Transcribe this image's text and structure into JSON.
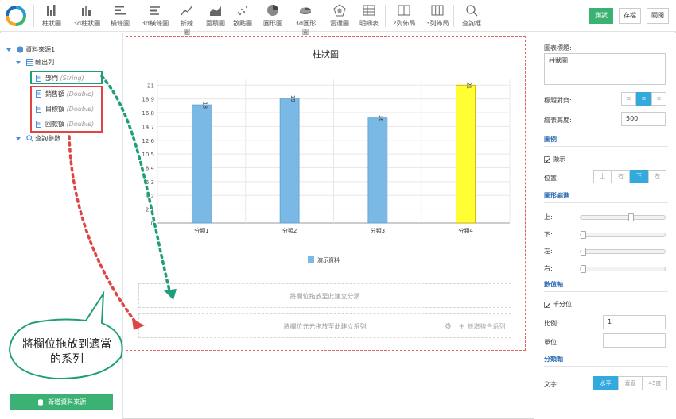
{
  "toolbar": {
    "items": [
      {
        "label": "柱狀圖",
        "icon": "bar-chart-icon"
      },
      {
        "label": "3d柱狀圖",
        "icon": "bar-3d-chart-icon"
      },
      {
        "label": "橫條圖",
        "icon": "horizontal-bar-icon"
      },
      {
        "label": "3d橫條圖",
        "icon": "horizontal-bar-3d-icon"
      },
      {
        "label": "折線圖",
        "icon": "line-chart-icon"
      },
      {
        "label": "面積圖",
        "icon": "area-chart-icon"
      },
      {
        "label": "散點圖",
        "icon": "scatter-chart-icon"
      },
      {
        "label": "圓形圖",
        "icon": "pie-chart-icon"
      },
      {
        "label": "3d圓形圖",
        "icon": "pie-3d-chart-icon"
      },
      {
        "label": "雷達圖",
        "icon": "radar-chart-icon"
      },
      {
        "label": "明細表",
        "icon": "table-icon"
      },
      {
        "label": "2列佈局",
        "icon": "two-column-layout-icon"
      },
      {
        "label": "3列佈局",
        "icon": "three-column-layout-icon"
      },
      {
        "label": "查詢框",
        "icon": "search-icon"
      }
    ],
    "test_label": "測試",
    "save_label": "存檔",
    "close_label": "關閉",
    "accent": "#3bb273"
  },
  "left": {
    "datasource": "資料來源1",
    "output": "輸出列",
    "fields": [
      {
        "name": "部門",
        "type": "(String)"
      },
      {
        "name": "銷售額",
        "type": "(Double)"
      },
      {
        "name": "目標額",
        "type": "(Double)"
      },
      {
        "name": "回款額",
        "type": "(Double)"
      }
    ],
    "query_params": "查詢參數",
    "add_source": "新增資料來源"
  },
  "center": {
    "dropzone_category": "將欄位拖放至此建立分類",
    "dropzone_series": "將欄位元元拖放至此建立系列",
    "add_combo": "新增複合系列",
    "callout": "將欄位拖放到適當的系列"
  },
  "chart_data": {
    "type": "bar",
    "title": "柱狀圖",
    "categories": [
      "分類1",
      "分類2",
      "分類3",
      "分類4"
    ],
    "series": [
      {
        "name": "演示資料",
        "values": [
          18,
          19,
          16,
          21
        ]
      }
    ],
    "bar_labels": [
      "18",
      "19",
      "16",
      "21"
    ],
    "ylim": [
      0,
      22
    ],
    "yticks": [
      "0",
      "2.1",
      "4.2",
      "6.3",
      "8.4",
      "10.5",
      "12.6",
      "14.7",
      "16.8",
      "18.9",
      "21"
    ],
    "bar_color": "#7ab8e6",
    "highlight_color": "#ffff33",
    "highlight_index": 3,
    "legend": "bottom",
    "grid": true
  },
  "right": {
    "chart_title_label": "圖表標題:",
    "chart_title_value": "柱狀圖",
    "title_align_label": "標題對齊:",
    "align_options": [
      "左",
      "中",
      "右"
    ],
    "height_label": "繪表高度:",
    "height_value": "500",
    "legend_section": "圖例",
    "show_label": "顯示",
    "position_label": "位置:",
    "position_options": [
      "上",
      "右",
      "下",
      "左"
    ],
    "margin_section": "圖形縮進",
    "margin_labels": [
      "上:",
      "下:",
      "左:",
      "右:"
    ],
    "value_axis_section": "數值軸",
    "thousands_label": "千分位",
    "ratio_label": "比例:",
    "ratio_value": "1",
    "unit_label": "單位:",
    "unit_value": "",
    "category_axis_section": "分類軸",
    "text_label": "文字:",
    "text_options": [
      "水平",
      "垂直",
      "45度"
    ]
  }
}
